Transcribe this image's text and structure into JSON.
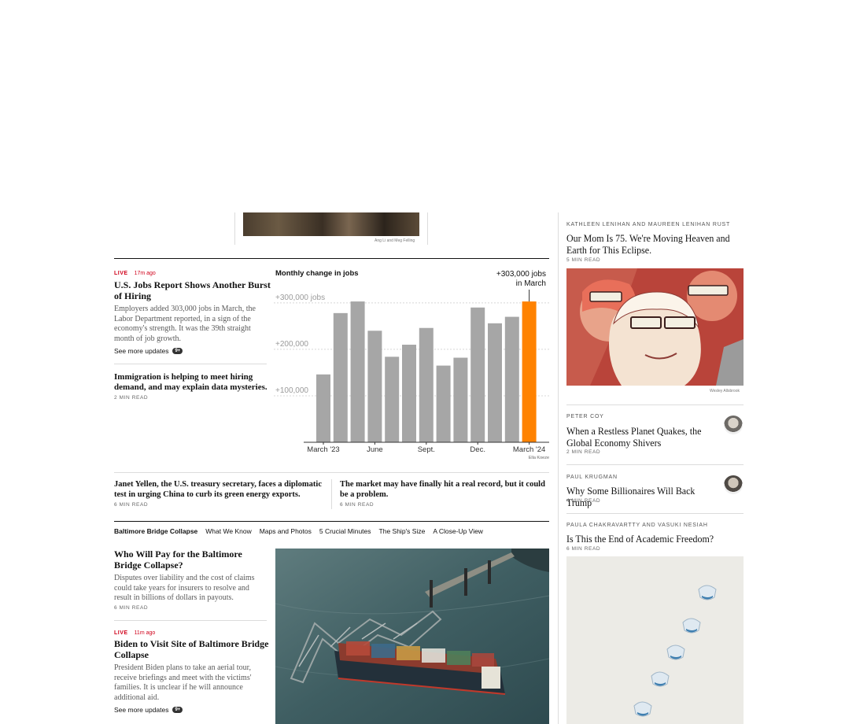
{
  "top_photo": {
    "credit": "Ang Li and Meg Felling"
  },
  "jobs": {
    "live": "LIVE",
    "ago": "17m ago",
    "headline": "U.S. Jobs Report Shows Another Burst of Hiring",
    "summary": "Employers added 303,000 jobs in March, the Labor Department reported, in a sign of the economy's strength. It was the 39th straight month of job growth.",
    "see_more": "See more updates",
    "badge": "9+"
  },
  "immigration": {
    "headline": "Immigration is helping to meet hiring demand, and may explain data mysteries.",
    "read": "2 MIN READ"
  },
  "chart_data": {
    "type": "bar",
    "title": "Monthly change in jobs",
    "annotation_value": "+303,000 jobs",
    "annotation_text": "in March",
    "x_tick_labels": [
      "March '23",
      "June",
      "Sept.",
      "Dec.",
      "March '24"
    ],
    "y_tick_labels": [
      "+100,000",
      "+200,000",
      "+300,000 jobs"
    ],
    "y_ticks": [
      100000,
      200000,
      300000
    ],
    "ylim": [
      0,
      315000
    ],
    "categories": [
      "Mar 2023",
      "Apr 2023",
      "May 2023",
      "Jun 2023",
      "Jul 2023",
      "Aug 2023",
      "Sep 2023",
      "Oct 2023",
      "Nov 2023",
      "Dec 2023",
      "Jan 2024",
      "Feb 2024",
      "Mar 2024"
    ],
    "values": [
      146000,
      278000,
      303000,
      240000,
      184000,
      210000,
      246000,
      165000,
      182000,
      290000,
      256000,
      270000,
      303000
    ],
    "bar_color": "#a6a6a6",
    "highlight_color": "#ff8200",
    "highlight_index": 12,
    "credit": "Ella Koeze"
  },
  "yellen": {
    "headline": "Janet Yellen, the U.S. treasury secretary, faces a diplomatic test in urging China to curb its green energy exports.",
    "read": "6 MIN READ"
  },
  "market": {
    "headline": "The market may have finally hit a real record, but it could be a problem.",
    "read": "6 MIN READ"
  },
  "bridge_nav": {
    "title": "Baltimore Bridge Collapse",
    "links": [
      "What We Know",
      "Maps and Photos",
      "5 Crucial Minutes",
      "The Ship's Size",
      "A Close-Up View"
    ]
  },
  "bridge1": {
    "headline": "Who Will Pay for the Baltimore Bridge Collapse?",
    "summary": "Disputes over liability and the cost of claims could take years for insurers to resolve and result in billions of dollars in payouts.",
    "read": "6 MIN READ"
  },
  "bridge2": {
    "live": "LIVE",
    "ago": "11m ago",
    "headline": "Biden to Visit Site of Baltimore Bridge Collapse",
    "summary": "President Biden plans to take an aerial tour, receive briefings and meet with the victims' families. It is unclear if he will announce additional aid.",
    "see_more": "See more updates",
    "badge": "9+"
  },
  "opinion": [
    {
      "byline": "KATHLEEN LENIHAN AND MAUREEN LENIHAN RUST",
      "headline": "Our Mom Is 75. We're Moving Heaven and Earth for This Eclipse.",
      "read": "5 MIN READ",
      "credit": "Wesley Allsbrook"
    },
    {
      "byline": "PETER COY",
      "headline": "When a Restless Planet Quakes, the Global Economy Shivers",
      "read": "2 MIN READ"
    },
    {
      "byline": "PAUL KRUGMAN",
      "headline": "Why Some Billionaires Will Back Trump",
      "read": "4 MIN READ"
    },
    {
      "byline": "PAULA CHAKRAVARTTY AND VASUKI NESIAH",
      "headline": "Is This the End of Academic Freedom?",
      "read": "6 MIN READ"
    }
  ]
}
